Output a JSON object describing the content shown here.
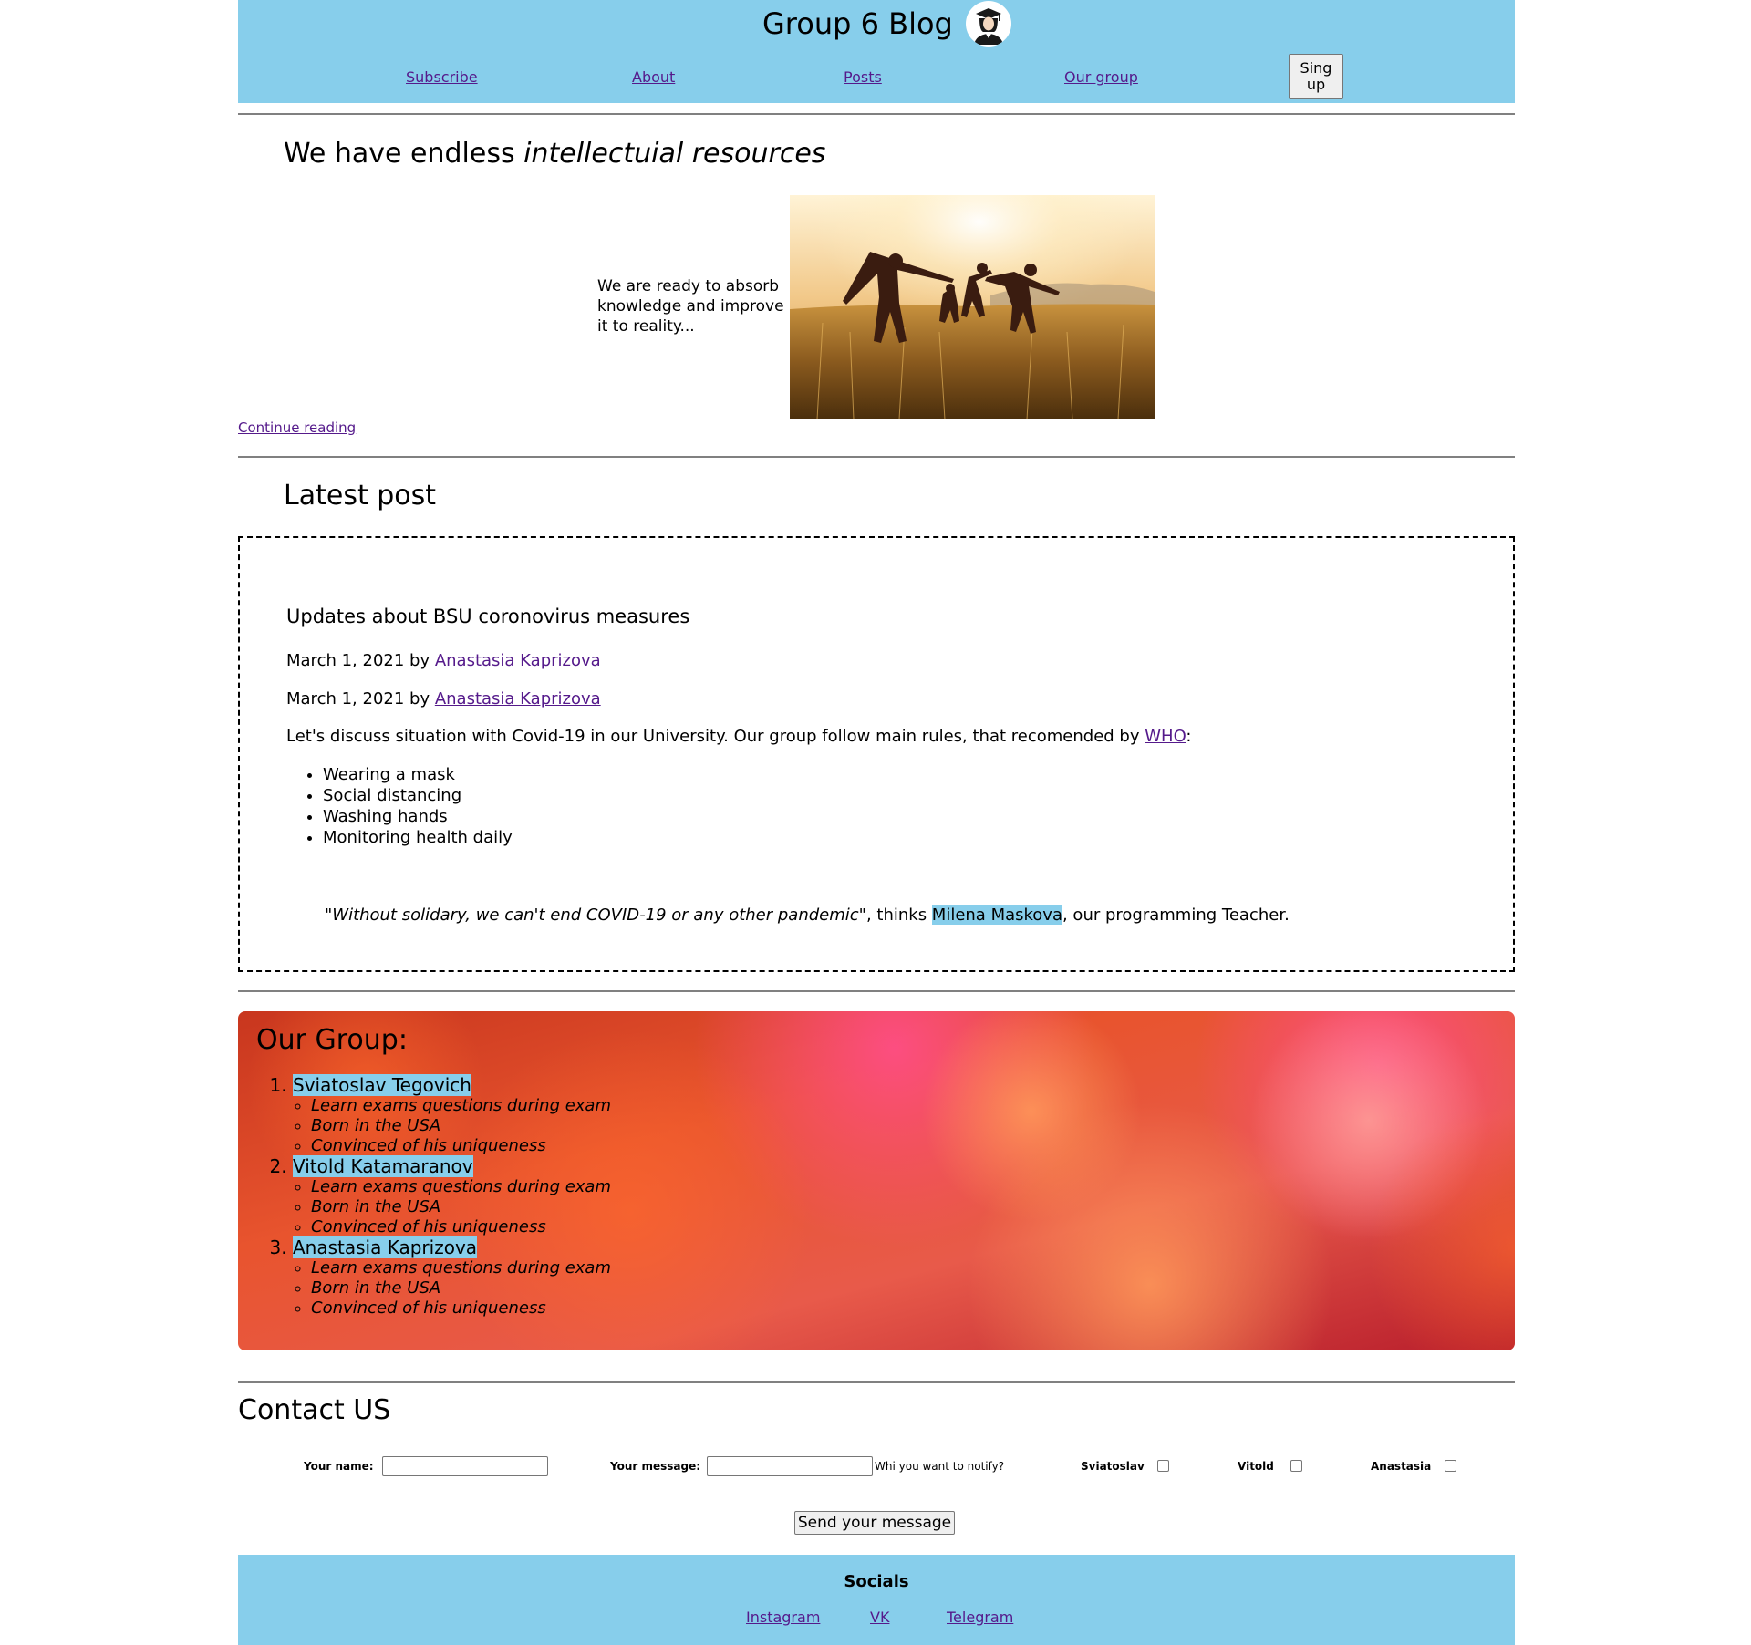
{
  "header": {
    "title": "Group 6 Blog",
    "nav": [
      "Subscribe",
      "About",
      "Posts",
      "Our group"
    ],
    "signup_label": "Sing up",
    "avatar_icon": "graduate-avatar-icon",
    "background_color": "#87ceeb"
  },
  "hero": {
    "heading_plain": "We have endless ",
    "heading_italic": "intellectuial resources",
    "text": "We are ready to absorb knowledge and improve it to reality...",
    "image": "family-running-in-field-photo",
    "continue_label": "Continue reading"
  },
  "latest": {
    "heading": "Latest post",
    "post": {
      "title": "Updates about BSU coronovirus measures",
      "meta": [
        {
          "date": "March 1, 2021 by ",
          "author": "Anastasia Kaprizova"
        },
        {
          "date": "March 1, 2021 by ",
          "author": "Anastasia Kaprizova"
        }
      ],
      "intro": "Let's discuss situation with Covid-19 in our University. Our group follow main rules, that recomended by ",
      "intro_link": "WHO",
      "intro_suffix": ":",
      "rules": [
        "Wearing a mask",
        "Social distancing",
        "Washing hands",
        "Monitoring health daily"
      ],
      "quote": {
        "text": "\"Without solidary, we can't end COVID-19 or any other pandemic\"",
        "mid": ", thinks ",
        "person": "Milena Maskova",
        "end": ", our programming Teacher."
      }
    }
  },
  "group": {
    "heading": "Our Group:",
    "members": [
      {
        "name": "Sviatoslav Tegovich",
        "facts": [
          "Learn exams questions during exam",
          "Born in the USA",
          "Convinced of his uniqueness"
        ]
      },
      {
        "name": "Vitold Katamaranov",
        "facts": [
          "Learn exams questions during exam",
          "Born in the USA",
          "Convinced of his uniqueness"
        ]
      },
      {
        "name": "Anastasia Kaprizova",
        "facts": [
          "Learn exams questions during exam",
          "Born in the USA",
          "Convinced of his uniqueness"
        ]
      }
    ],
    "background": "orange-pink-bokeh"
  },
  "contact": {
    "heading": "Contact US",
    "name_label": "Your name:",
    "name_value": "",
    "message_label": "Your message:",
    "message_value": "",
    "notify_label": "Whi you want to notify?",
    "recipients": [
      "Sviatoslav",
      "Vitold",
      "Anastasia"
    ],
    "send_label": "Send your message"
  },
  "footer": {
    "title": "Socials",
    "links": [
      "Instagram",
      "VK",
      "Telegram"
    ]
  },
  "colors": {
    "accent": "#87ceeb",
    "link": "#551a8b",
    "highlight": "#87ceeb"
  }
}
